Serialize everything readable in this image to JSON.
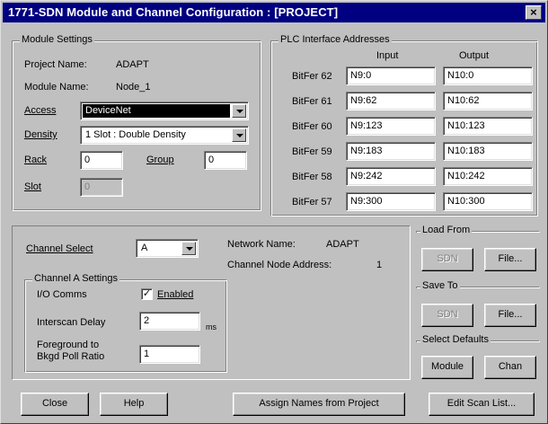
{
  "window": {
    "title": "1771-SDN Module and Channel Configuration : [PROJECT]",
    "close_glyph": "×"
  },
  "module_settings": {
    "legend": "Module Settings",
    "project_name_label": "Project Name:",
    "project_name_value": "ADAPT",
    "module_name_label": "Module Name:",
    "module_name_value": "Node_1",
    "access_label": "Access",
    "access_value": "DeviceNet",
    "density_label": "Density",
    "density_value": "1 Slot : Double Density",
    "rack_label": "Rack",
    "rack_value": "0",
    "group_label": "Group",
    "group_value": "0",
    "slot_label": "Slot",
    "slot_value": "0"
  },
  "plc_interface": {
    "legend": "PLC Interface Addresses",
    "input_header": "Input",
    "output_header": "Output",
    "rows": [
      {
        "label": "BitFer 62",
        "input": "N9:0",
        "output": "N10:0"
      },
      {
        "label": "BitFer 61",
        "input": "N9:62",
        "output": "N10:62"
      },
      {
        "label": "BitFer 60",
        "input": "N9:123",
        "output": "N10:123"
      },
      {
        "label": "BitFer 59",
        "input": "N9:183",
        "output": "N10:183"
      },
      {
        "label": "BitFer 58",
        "input": "N9:242",
        "output": "N10:242"
      },
      {
        "label": "BitFer 57",
        "input": "N9:300",
        "output": "N10:300"
      }
    ]
  },
  "channel": {
    "select_label": "Channel Select",
    "select_value": "A",
    "network_name_label": "Network Name:",
    "network_name_value": "ADAPT",
    "node_address_label": "Channel Node Address:",
    "node_address_value": "1",
    "settings_legend": "Channel A Settings",
    "io_comms_label": "I/O Comms",
    "enabled_label": "Enabled",
    "enabled_checked": true,
    "check_glyph": "✓",
    "interscan_label": "Interscan Delay",
    "interscan_value": "2",
    "interscan_unit": "ms",
    "foreground_label_1": "Foreground to",
    "foreground_label_2": "Bkgd Poll Ratio",
    "foreground_value": "1"
  },
  "load_from": {
    "legend": "Load From",
    "sdn_label": "SDN",
    "file_label": "File..."
  },
  "save_to": {
    "legend": "Save To",
    "sdn_label": "SDN",
    "file_label": "File..."
  },
  "select_defaults": {
    "legend": "Select Defaults",
    "module_label": "Module",
    "chan_label": "Chan"
  },
  "footer": {
    "close_label": "Close",
    "help_label": "Help",
    "assign_label": "Assign Names from Project",
    "edit_scan_label": "Edit Scan List..."
  }
}
